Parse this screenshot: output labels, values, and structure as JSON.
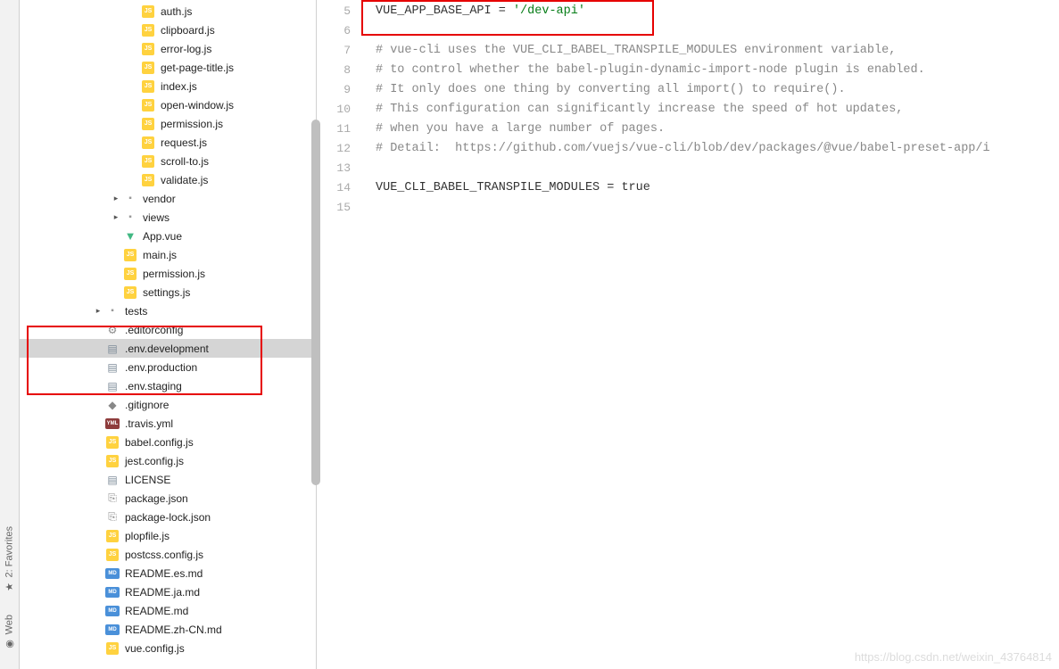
{
  "rail": {
    "favorites": "2: Favorites",
    "web": "Web"
  },
  "tree": [
    {
      "indent": 4,
      "icon": "js",
      "label": "auth.js"
    },
    {
      "indent": 4,
      "icon": "js",
      "label": "clipboard.js"
    },
    {
      "indent": 4,
      "icon": "js",
      "label": "error-log.js"
    },
    {
      "indent": 4,
      "icon": "js",
      "label": "get-page-title.js"
    },
    {
      "indent": 4,
      "icon": "js",
      "label": "index.js"
    },
    {
      "indent": 4,
      "icon": "js",
      "label": "open-window.js"
    },
    {
      "indent": 4,
      "icon": "js",
      "label": "permission.js"
    },
    {
      "indent": 4,
      "icon": "js",
      "label": "request.js"
    },
    {
      "indent": 4,
      "icon": "js",
      "label": "scroll-to.js"
    },
    {
      "indent": 4,
      "icon": "js",
      "label": "validate.js"
    },
    {
      "indent": 3,
      "icon": "folder",
      "label": "vendor",
      "arrow": "right"
    },
    {
      "indent": 3,
      "icon": "folder",
      "label": "views",
      "arrow": "right"
    },
    {
      "indent": 3,
      "icon": "vue",
      "label": "App.vue"
    },
    {
      "indent": 3,
      "icon": "js",
      "label": "main.js"
    },
    {
      "indent": 3,
      "icon": "js",
      "label": "permission.js"
    },
    {
      "indent": 3,
      "icon": "js",
      "label": "settings.js"
    },
    {
      "indent": 2,
      "icon": "folder",
      "label": "tests",
      "arrow": "right"
    },
    {
      "indent": 2,
      "icon": "gear",
      "label": ".editorconfig"
    },
    {
      "indent": 2,
      "icon": "txt",
      "label": ".env.development",
      "selected": true
    },
    {
      "indent": 2,
      "icon": "txt",
      "label": ".env.production"
    },
    {
      "indent": 2,
      "icon": "txt",
      "label": ".env.staging"
    },
    {
      "indent": 2,
      "icon": "git",
      "label": ".gitignore"
    },
    {
      "indent": 2,
      "icon": "yml",
      "label": ".travis.yml"
    },
    {
      "indent": 2,
      "icon": "js",
      "label": "babel.config.js"
    },
    {
      "indent": 2,
      "icon": "js",
      "label": "jest.config.js"
    },
    {
      "indent": 2,
      "icon": "txt",
      "label": "LICENSE"
    },
    {
      "indent": 2,
      "icon": "json",
      "label": "package.json"
    },
    {
      "indent": 2,
      "icon": "json",
      "label": "package-lock.json"
    },
    {
      "indent": 2,
      "icon": "js",
      "label": "plopfile.js"
    },
    {
      "indent": 2,
      "icon": "js",
      "label": "postcss.config.js"
    },
    {
      "indent": 2,
      "icon": "md",
      "label": "README.es.md"
    },
    {
      "indent": 2,
      "icon": "md",
      "label": "README.ja.md"
    },
    {
      "indent": 2,
      "icon": "md",
      "label": "README.md"
    },
    {
      "indent": 2,
      "icon": "md",
      "label": "README.zh-CN.md"
    },
    {
      "indent": 2,
      "icon": "js",
      "label": "vue.config.js"
    }
  ],
  "gutter_start": 5,
  "gutter_end": 15,
  "code_lines": [
    {
      "type": "plain",
      "prefix": "VUE_APP_BASE_API = ",
      "str": "'/dev-api'"
    },
    {
      "type": "blank"
    },
    {
      "type": "cmt",
      "text": "# vue-cli uses the VUE_CLI_BABEL_TRANSPILE_MODULES environment variable,"
    },
    {
      "type": "cmt",
      "text": "# to control whether the babel-plugin-dynamic-import-node plugin is enabled."
    },
    {
      "type": "cmt",
      "text": "# It only does one thing by converting all import() to require()."
    },
    {
      "type": "cmt",
      "text": "# This configuration can significantly increase the speed of hot updates,"
    },
    {
      "type": "cmt",
      "text": "# when you have a large number of pages."
    },
    {
      "type": "cmt",
      "text": "# Detail:  https://github.com/vuejs/vue-cli/blob/dev/packages/@vue/babel-preset-app/i"
    },
    {
      "type": "blank"
    },
    {
      "type": "plain",
      "prefix": "VUE_CLI_BABEL_TRANSPILE_MODULES = true",
      "str": ""
    },
    {
      "type": "blank"
    }
  ],
  "watermark": "https://blog.csdn.net/weixin_43764814"
}
